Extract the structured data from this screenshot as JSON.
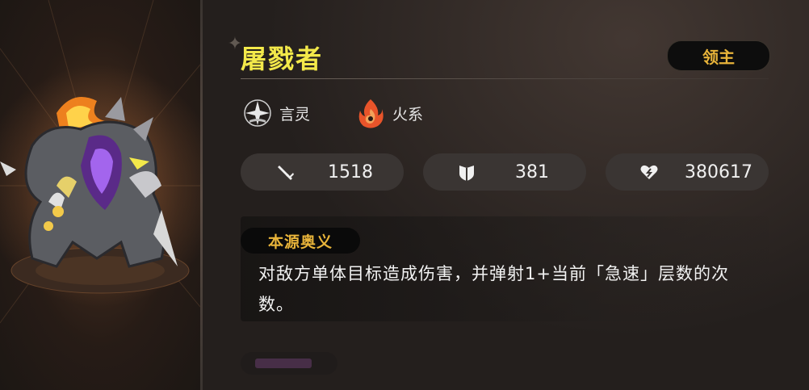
{
  "character": {
    "name": "屠戮者",
    "rank_badge": "领主",
    "tags": [
      {
        "label": "言灵",
        "icon": "spirit-word-icon"
      },
      {
        "label": "火系",
        "icon": "fire-element-icon"
      }
    ],
    "stats": [
      {
        "icon": "sword-attack-icon",
        "value": "1518"
      },
      {
        "icon": "shield-defense-icon",
        "value": "381"
      },
      {
        "icon": "heart-health-icon",
        "value": "380617"
      }
    ]
  },
  "skill": {
    "label": "本源奥义",
    "description": "对敌方单体目标造成伤害，并弹射1+当前「急速」层数的次数。"
  },
  "colors": {
    "name_yellow": "#f3e94a",
    "badge_gold": "#e8b43a",
    "stat_bg": "#3a3533",
    "panel_bg": "#242020"
  }
}
